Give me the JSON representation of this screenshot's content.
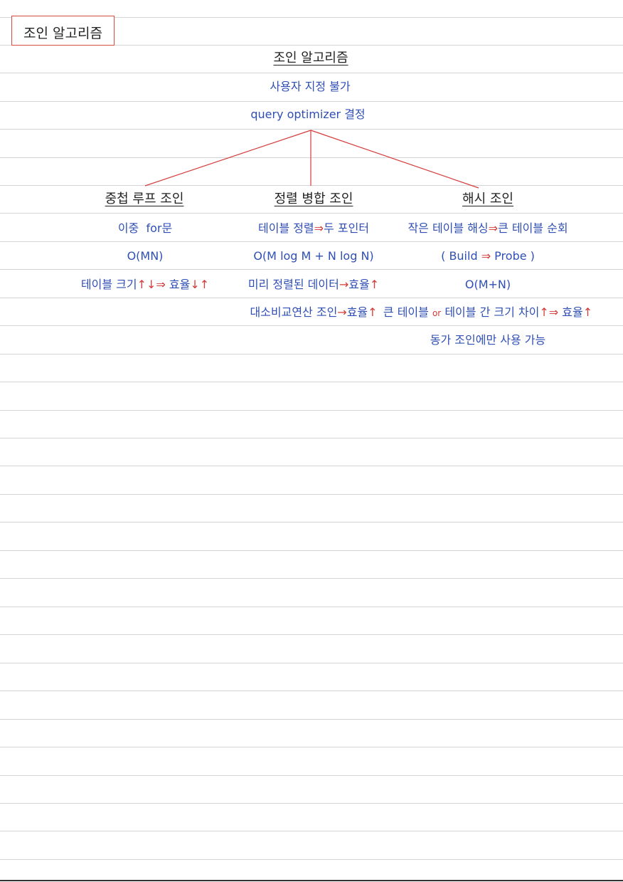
{
  "header": {
    "box_label": "조인 알고리즘"
  },
  "root": {
    "title": "조인 알고리즘",
    "line1": "사용자 지정 불가",
    "line2": "query optimizer 결정"
  },
  "columns": [
    {
      "heading": "중첩 루프 조인",
      "lines": [
        [
          {
            "t": "이중  for문",
            "c": "blue"
          }
        ],
        [
          {
            "t": "O(MN)",
            "c": "blue"
          }
        ],
        [
          {
            "t": "테이블 크기",
            "c": "blue"
          },
          {
            "t": "↑↓⇒",
            "c": "red"
          },
          {
            "t": " 효율",
            "c": "blue"
          },
          {
            "t": "↓↑",
            "c": "red"
          }
        ]
      ]
    },
    {
      "heading": "정렬 병합 조인",
      "lines": [
        [
          {
            "t": "테이블 정렬",
            "c": "blue"
          },
          {
            "t": "⇒",
            "c": "red"
          },
          {
            "t": "두 포인터",
            "c": "blue"
          }
        ],
        [
          {
            "t": "O(M log M + N log N)",
            "c": "blue"
          }
        ],
        [
          {
            "t": "미리 정렬된 데이터",
            "c": "blue"
          },
          {
            "t": "→",
            "c": "red"
          },
          {
            "t": "효율",
            "c": "blue"
          },
          {
            "t": "↑",
            "c": "red"
          }
        ],
        [
          {
            "t": "대소비교연산 조인",
            "c": "blue"
          },
          {
            "t": "→",
            "c": "red"
          },
          {
            "t": "효율",
            "c": "blue"
          },
          {
            "t": "↑",
            "c": "red"
          }
        ]
      ]
    },
    {
      "heading": "해시 조인",
      "lines": [
        [
          {
            "t": "작은 테이블 해싱",
            "c": "blue"
          },
          {
            "t": "⇒",
            "c": "red"
          },
          {
            "t": "큰 테이블 순회",
            "c": "blue"
          }
        ],
        [
          {
            "t": "( Build ",
            "c": "blue"
          },
          {
            "t": "⇒",
            "c": "red"
          },
          {
            "t": " Probe )",
            "c": "blue"
          }
        ],
        [
          {
            "t": "O(M+N)",
            "c": "blue"
          }
        ],
        [
          {
            "t": "큰 테이블 ",
            "c": "blue"
          },
          {
            "t": "or",
            "c": "red",
            "small": true
          },
          {
            "t": " 테이블 간 크기 차이",
            "c": "blue"
          },
          {
            "t": "↑⇒",
            "c": "red"
          },
          {
            "t": " 효율",
            "c": "blue"
          },
          {
            "t": "↑",
            "c": "red"
          }
        ],
        [
          {
            "t": "동가 조인에만 사용 가능",
            "c": "blue"
          }
        ]
      ]
    }
  ],
  "colors": {
    "ink_blue": "#2f4fb5",
    "ink_red": "#d43a3a",
    "ink_dark": "#222222",
    "rule": "#d4d4d4"
  }
}
